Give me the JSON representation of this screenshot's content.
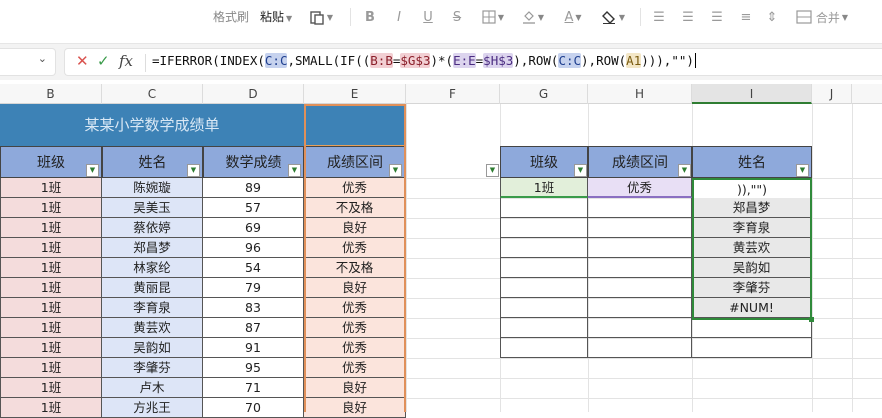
{
  "ribbon": {
    "format_painter": "格式刷",
    "paste": "粘贴",
    "merge": "合并",
    "bold": "B",
    "italic": "I",
    "underline": "U",
    "strike": "S",
    "font_color": "A"
  },
  "formula_bar": {
    "name_box": "",
    "cancel": "✕",
    "confirm": "✓",
    "fx": "fx",
    "parts": [
      "=IFERROR(INDEX(",
      "C:C",
      ",SMALL(IF((",
      "B:B",
      "=",
      "$G$3",
      ")*(",
      "E:E",
      "=",
      "$H$3",
      "),ROW(",
      "C:C",
      "),ROW(",
      "A1",
      "))),\"\")"
    ]
  },
  "columns": [
    "B",
    "C",
    "D",
    "E",
    "F",
    "G",
    "H",
    "I",
    "J"
  ],
  "left_table": {
    "title": "某某小学数学成绩单",
    "headers": [
      "班级",
      "姓名",
      "数学成绩",
      "成绩区间"
    ],
    "rows": [
      [
        "1班",
        "陈婉璇",
        "89",
        "优秀"
      ],
      [
        "1班",
        "吴美玉",
        "57",
        "不及格"
      ],
      [
        "1班",
        "蔡依婷",
        "69",
        "良好"
      ],
      [
        "1班",
        "郑昌梦",
        "96",
        "优秀"
      ],
      [
        "1班",
        "林家纶",
        "54",
        "不及格"
      ],
      [
        "1班",
        "黄丽昆",
        "79",
        "良好"
      ],
      [
        "1班",
        "李育泉",
        "83",
        "优秀"
      ],
      [
        "1班",
        "黄芸欢",
        "87",
        "优秀"
      ],
      [
        "1班",
        "吴韵如",
        "91",
        "优秀"
      ],
      [
        "1班",
        "李肇芬",
        "95",
        "优秀"
      ],
      [
        "1班",
        "卢木",
        "71",
        "良好"
      ],
      [
        "1班",
        "方兆王",
        "70",
        "良好"
      ]
    ]
  },
  "right_table": {
    "headers": [
      "班级",
      "成绩区间",
      "姓名"
    ],
    "criteria": [
      "1班",
      "优秀"
    ],
    "editing_text": ")),\"\")",
    "results": [
      "郑昌梦",
      "李育泉",
      "黄芸欢",
      "吴韵如",
      "李肇芬",
      "#NUM!"
    ]
  },
  "colors": {
    "title_bg": "#3d82b6",
    "header_bg": "#8ea9db",
    "class_col_bg": "#f4dcdc",
    "name_col_bg": "#dde5f7",
    "zone_col_bg": "#fbe4dc",
    "g3_bg": "#e2efda",
    "h3_bg": "#e8dff5",
    "result_bg": "#e8e8e8",
    "selection_green": "#2f8a3a",
    "selection_orange": "#e0905a"
  }
}
